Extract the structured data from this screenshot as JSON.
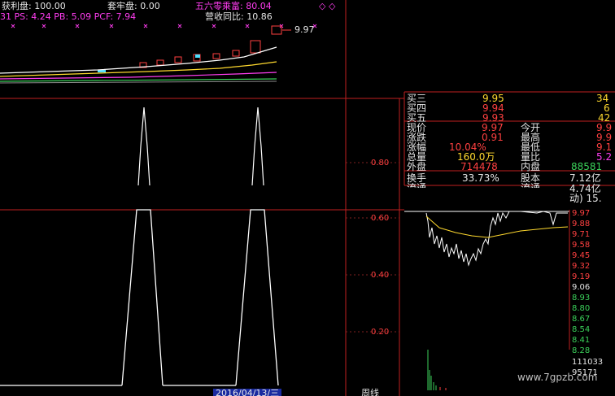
{
  "header": {
    "row1": {
      "a": "获利盘: 100.00",
      "b": "套牢盘: 0.00",
      "c": "五六零乘富: 80.04",
      "markers": "◇ ◇"
    },
    "row2": {
      "a": "31 PS: 4.24 PB: 5.09 PCF: 7.94",
      "b": "营收同比: 10.86"
    },
    "price_flag": "9.97"
  },
  "axis": {
    "mid": [
      "0.80"
    ],
    "low": [
      "0.60",
      "0.40",
      "0.20"
    ]
  },
  "quotes": {
    "asks": [
      {
        "label": "买三",
        "price": "9.95",
        "vol": "34"
      },
      {
        "label": "买四",
        "price": "9.94",
        "vol": "6"
      },
      {
        "label": "买五",
        "price": "9.93",
        "vol": "42"
      }
    ],
    "stats": [
      {
        "l1": "现价",
        "v1": "9.97",
        "l2": "今开",
        "v2": "9.9"
      },
      {
        "l1": "涨跌",
        "v1": "0.91",
        "l2": "最高",
        "v2": "9.9"
      },
      {
        "l1": "涨幅",
        "v1": "10.04%",
        "l2": "最低",
        "v2": "9.1"
      },
      {
        "l1": "总量",
        "v1": "160.0万",
        "l2": "量比",
        "v2": "5.2"
      },
      {
        "l1": "外盘",
        "v1": "714478",
        "l2": "内盘",
        "v2": "88581"
      }
    ],
    "extra": [
      {
        "l1": "换手",
        "v1": "33.73%",
        "l2": "股本",
        "v2": "7.12亿"
      },
      {
        "l1": "流通",
        "v1": "",
        "l2": "流通",
        "v2": "4.74亿"
      }
    ],
    "trail": "动)    15."
  },
  "mini_axis": {
    "prices": [
      "9.97",
      "9.88",
      "9.71",
      "9.58",
      "9.45",
      "9.32",
      "9.19",
      "9.06",
      "8.93",
      "8.80",
      "8.67",
      "8.54",
      "8.41",
      "8.28"
    ],
    "volumes": [
      "111033",
      "95171"
    ]
  },
  "footer": {
    "date": "2016/04/13/三",
    "tab": "周线"
  },
  "watermark": "www.7gpzb.com",
  "colors": {
    "up": "#ff4040",
    "down": "#3bd15a",
    "price": "#ffd92e"
  }
}
